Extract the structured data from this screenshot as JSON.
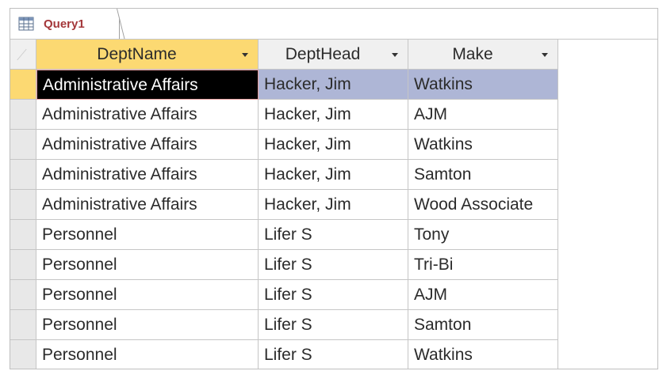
{
  "tab": {
    "label": "Query1",
    "icon": "query-icon"
  },
  "columns": [
    {
      "label": "DeptName",
      "sorted": true
    },
    {
      "label": "DeptHead",
      "sorted": false
    },
    {
      "label": "Make",
      "sorted": false
    }
  ],
  "rows": [
    [
      "Administrative Affairs",
      "Hacker, Jim",
      "Watkins"
    ],
    [
      "Administrative Affairs",
      "Hacker, Jim",
      "AJM"
    ],
    [
      "Administrative Affairs",
      "Hacker, Jim",
      "Watkins"
    ],
    [
      "Administrative Affairs",
      "Hacker, Jim",
      "Samton"
    ],
    [
      "Administrative Affairs",
      "Hacker, Jim",
      "Wood Associate"
    ],
    [
      "Personnel",
      "Lifer S",
      "Tony"
    ],
    [
      "Personnel",
      "Lifer S",
      "Tri-Bi"
    ],
    [
      "Personnel",
      "Lifer S",
      "AJM"
    ],
    [
      "Personnel",
      "Lifer S",
      "Samton"
    ],
    [
      "Personnel",
      "Lifer S",
      "Watkins"
    ]
  ],
  "selection": {
    "row": 0,
    "active_cell": 0
  },
  "colors": {
    "tab_text": "#a4373a",
    "header_sorted": "#fcd972",
    "row_selected": "#aeb6d6",
    "active_cell": "#000000"
  }
}
